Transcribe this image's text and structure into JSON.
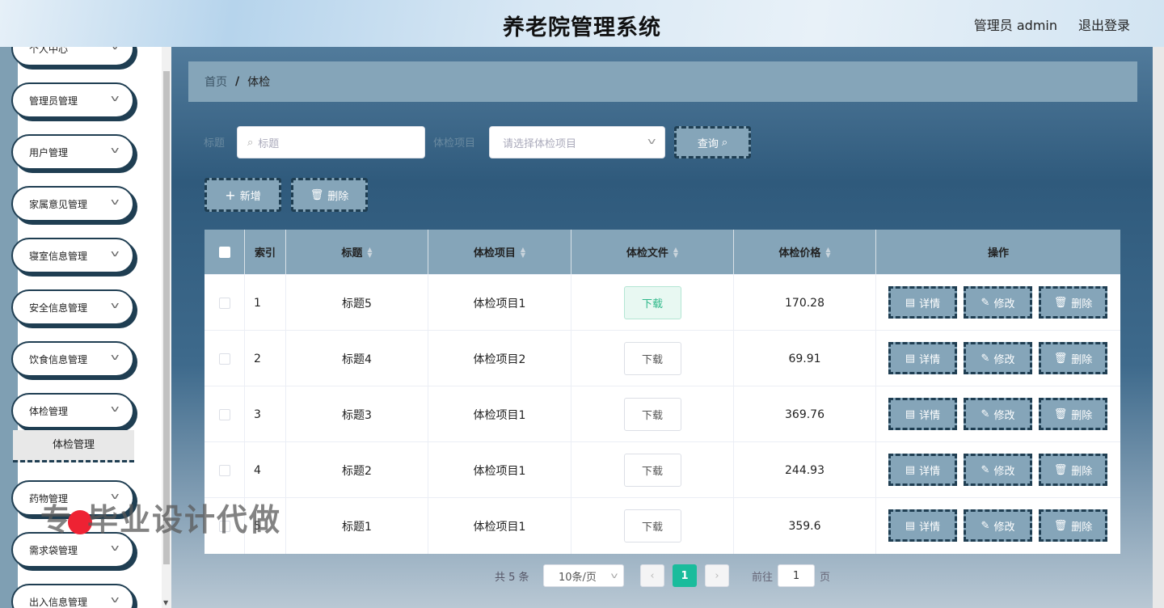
{
  "header": {
    "title": "养老院管理系统",
    "user": "管理员 admin",
    "logout": "退出登录"
  },
  "sidebar": {
    "items": [
      {
        "label": "个人中心"
      },
      {
        "label": "管理员管理"
      },
      {
        "label": "用户管理"
      },
      {
        "label": "家属意见管理"
      },
      {
        "label": "寝室信息管理"
      },
      {
        "label": "安全信息管理"
      },
      {
        "label": "饮食信息管理"
      },
      {
        "label": "体检管理"
      },
      {
        "label": "药物管理"
      },
      {
        "label": "需求袋管理"
      },
      {
        "label": "出入信息管理"
      }
    ],
    "submenu": "体检管理"
  },
  "watermark": {
    "left": "专",
    "right": "毕业设计代做"
  },
  "breadcrumb": {
    "home": "首页",
    "sep": "/",
    "current": "体检"
  },
  "search": {
    "title_label": "标题",
    "title_placeholder": "标题",
    "item_label": "体检项目",
    "item_placeholder": "请选择体检项目",
    "query_button": "查询"
  },
  "toolbar": {
    "add": "新增",
    "delete": "删除"
  },
  "table": {
    "columns": [
      "索引",
      "标题",
      "体检项目",
      "体检文件",
      "体检价格",
      "操作"
    ],
    "rows": [
      {
        "index": "1",
        "title": "标题5",
        "item": "体检项目1",
        "file": "下载",
        "price": "170.28"
      },
      {
        "index": "2",
        "title": "标题4",
        "item": "体检项目2",
        "file": "下载",
        "price": "69.91"
      },
      {
        "index": "3",
        "title": "标题3",
        "item": "体检项目1",
        "file": "下载",
        "price": "369.76"
      },
      {
        "index": "4",
        "title": "标题2",
        "item": "体检项目1",
        "file": "下载",
        "price": "244.93"
      },
      {
        "index": "5",
        "title": "标题1",
        "item": "体检项目1",
        "file": "下载",
        "price": "359.6"
      }
    ],
    "actions": {
      "detail": "详情",
      "edit": "修改",
      "delete": "删除"
    }
  },
  "pager": {
    "total": "共 5 条",
    "size": "10条/页",
    "current": "1",
    "goto": "前往",
    "goto_value": "1",
    "unit": "页"
  },
  "colors": {
    "accent": "#85a5b9",
    "border": "#1f3e52",
    "active_page": "#1abc9c"
  }
}
